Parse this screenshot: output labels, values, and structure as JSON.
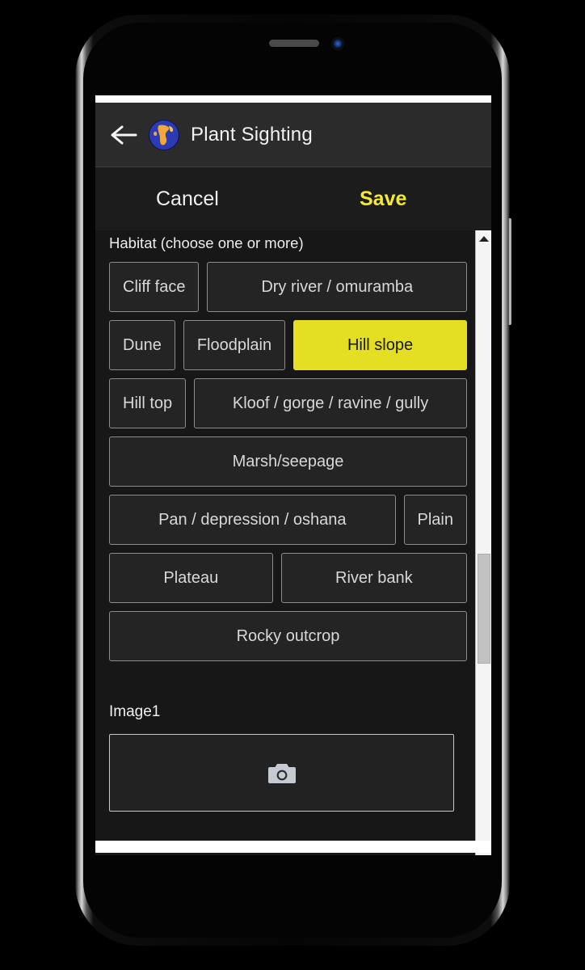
{
  "app": {
    "title": "Plant Sighting",
    "back_icon": "arrow-left-icon",
    "logo_icon": "globe-icon"
  },
  "actions": {
    "cancel_label": "Cancel",
    "save_label": "Save",
    "save_color": "#f5e92a"
  },
  "form": {
    "habitat": {
      "label": "Habitat (choose one or more)",
      "rows": [
        [
          {
            "label": "Cliff face",
            "selected": false,
            "grow": false
          },
          {
            "label": "Dry river / omuramba",
            "selected": false,
            "grow": true
          }
        ],
        [
          {
            "label": "Dune",
            "selected": false,
            "grow": false
          },
          {
            "label": "Floodplain",
            "selected": false,
            "grow": false
          },
          {
            "label": "Hill slope",
            "selected": true,
            "grow": true
          }
        ],
        [
          {
            "label": "Hill top",
            "selected": false,
            "grow": false
          },
          {
            "label": "Kloof / gorge / ravine / gully",
            "selected": false,
            "grow": true
          }
        ],
        [
          {
            "label": "Marsh/seepage",
            "selected": false,
            "grow": true
          }
        ],
        [
          {
            "label": "Pan / depression / oshana",
            "selected": false,
            "grow": true
          },
          {
            "label": "Plain",
            "selected": false,
            "grow": false
          }
        ],
        [
          {
            "label": "Plateau",
            "selected": false,
            "grow": true
          },
          {
            "label": "River bank",
            "selected": false,
            "grow": true
          }
        ],
        [
          {
            "label": "Rocky outcrop",
            "selected": false,
            "grow": true
          }
        ]
      ],
      "selected_color": "#e4df22"
    },
    "image": {
      "label": "Image1",
      "placeholder_icon": "camera-icon"
    }
  },
  "scrollbar": {
    "up_icon": "triangle-up-icon",
    "down_icon": "triangle-down-icon",
    "thumb": "scroll-thumb"
  },
  "device": {
    "speaker": "speaker-grille",
    "camera": "front-camera-lens",
    "side_button": "power-button"
  }
}
